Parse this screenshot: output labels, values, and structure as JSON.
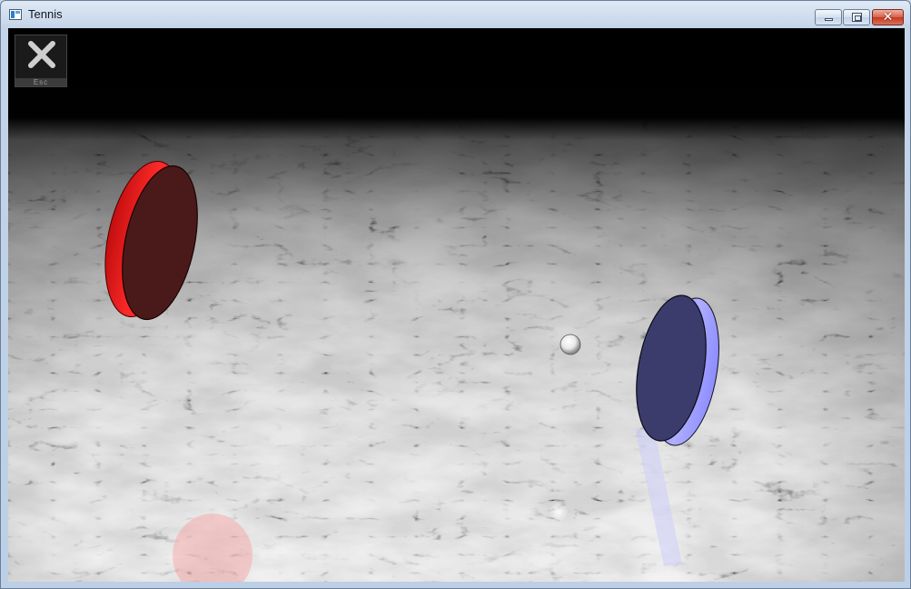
{
  "window": {
    "title": "Tennis",
    "icon": "app-window-icon",
    "controls": {
      "minimize_icon": "minimize-icon",
      "maximize_icon": "restore-icon",
      "close_icon": "close-icon",
      "close_glyph": "✕"
    }
  },
  "hud": {
    "esc_label": "Esc",
    "esc_icon": "close-x-icon"
  },
  "scene": {
    "floor": "marble",
    "sky_color": "#000000",
    "players": [
      {
        "name": "red-paddle",
        "color": "#d81818"
      },
      {
        "name": "blue-paddle",
        "color": "#8c8cff"
      }
    ],
    "ball_color": "#ffffff"
  },
  "colors": {
    "titlebar": "#c4d4e8",
    "close_button": "#c23a22",
    "red_paddle": "#d81818",
    "red_paddle_face": "#4a1a1a",
    "blue_paddle": "#8c8cff",
    "blue_paddle_face": "#3c3c6c"
  }
}
